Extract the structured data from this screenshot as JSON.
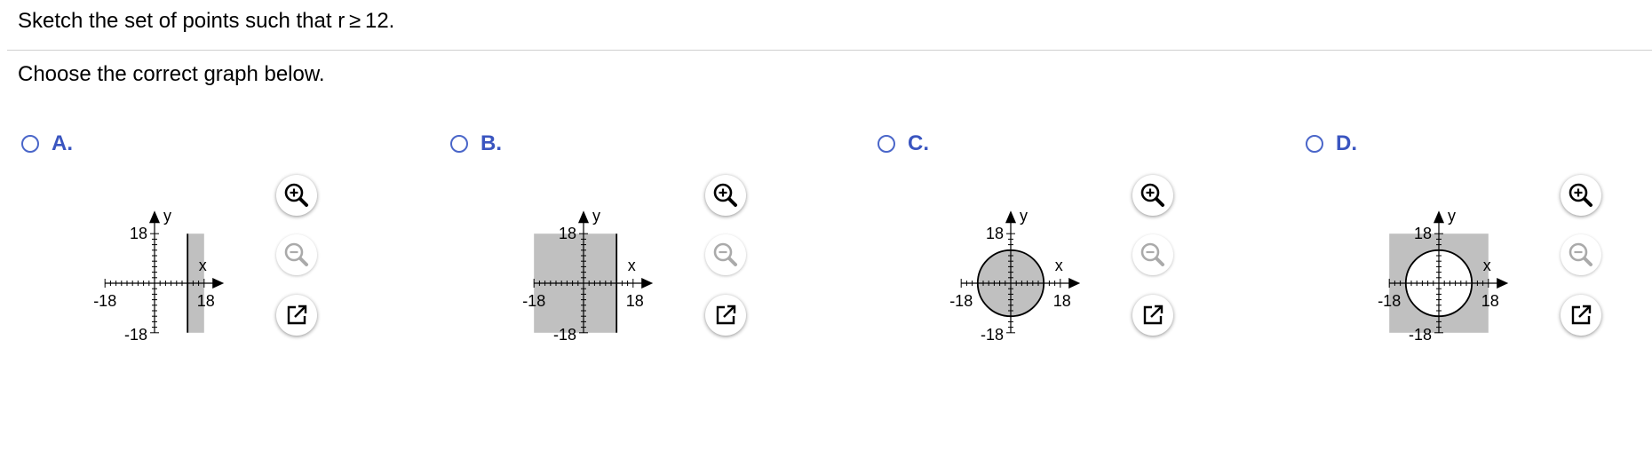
{
  "question": {
    "text": "Sketch the set of points such that r ≥ 12."
  },
  "instruction": "Choose the correct graph below.",
  "options": [
    {
      "letter": "A.",
      "region": "vertical-strip",
      "selected": false
    },
    {
      "letter": "B.",
      "region": "left-of-line",
      "selected": false
    },
    {
      "letter": "C.",
      "region": "disk-inside",
      "selected": false
    },
    {
      "letter": "D.",
      "region": "outside-circle",
      "selected": false
    }
  ],
  "axis": {
    "min_label": "-18",
    "max_label": "18",
    "x_label": "x",
    "y_label": "y",
    "range": [
      -18,
      18
    ],
    "tick_step": 2
  },
  "graph_fill_color": "#c0c0c0",
  "tools": {
    "zoom_in": "zoom-in-icon",
    "zoom_out": "zoom-out-icon",
    "open": "open-external-icon"
  }
}
